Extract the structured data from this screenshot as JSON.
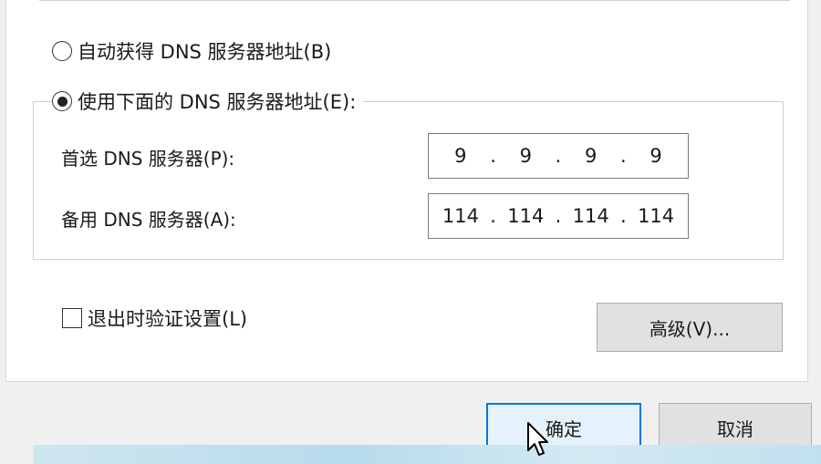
{
  "dns": {
    "auto_label": "自动获得 DNS 服务器地址(B)",
    "manual_label": "使用下面的 DNS 服务器地址(E):",
    "selected": "manual",
    "preferred": {
      "label": "首选 DNS 服务器(P):",
      "octets": [
        "9",
        "9",
        "9",
        "9"
      ]
    },
    "alternate": {
      "label": "备用 DNS 服务器(A):",
      "octets": [
        "114",
        "114",
        "114",
        "114"
      ]
    },
    "dot": "."
  },
  "validate": {
    "label": "退出时验证设置(L)",
    "checked": false
  },
  "buttons": {
    "advanced": "高级(V)...",
    "ok": "确定",
    "cancel": "取消"
  },
  "colors": {
    "accent": "#0078d7"
  }
}
